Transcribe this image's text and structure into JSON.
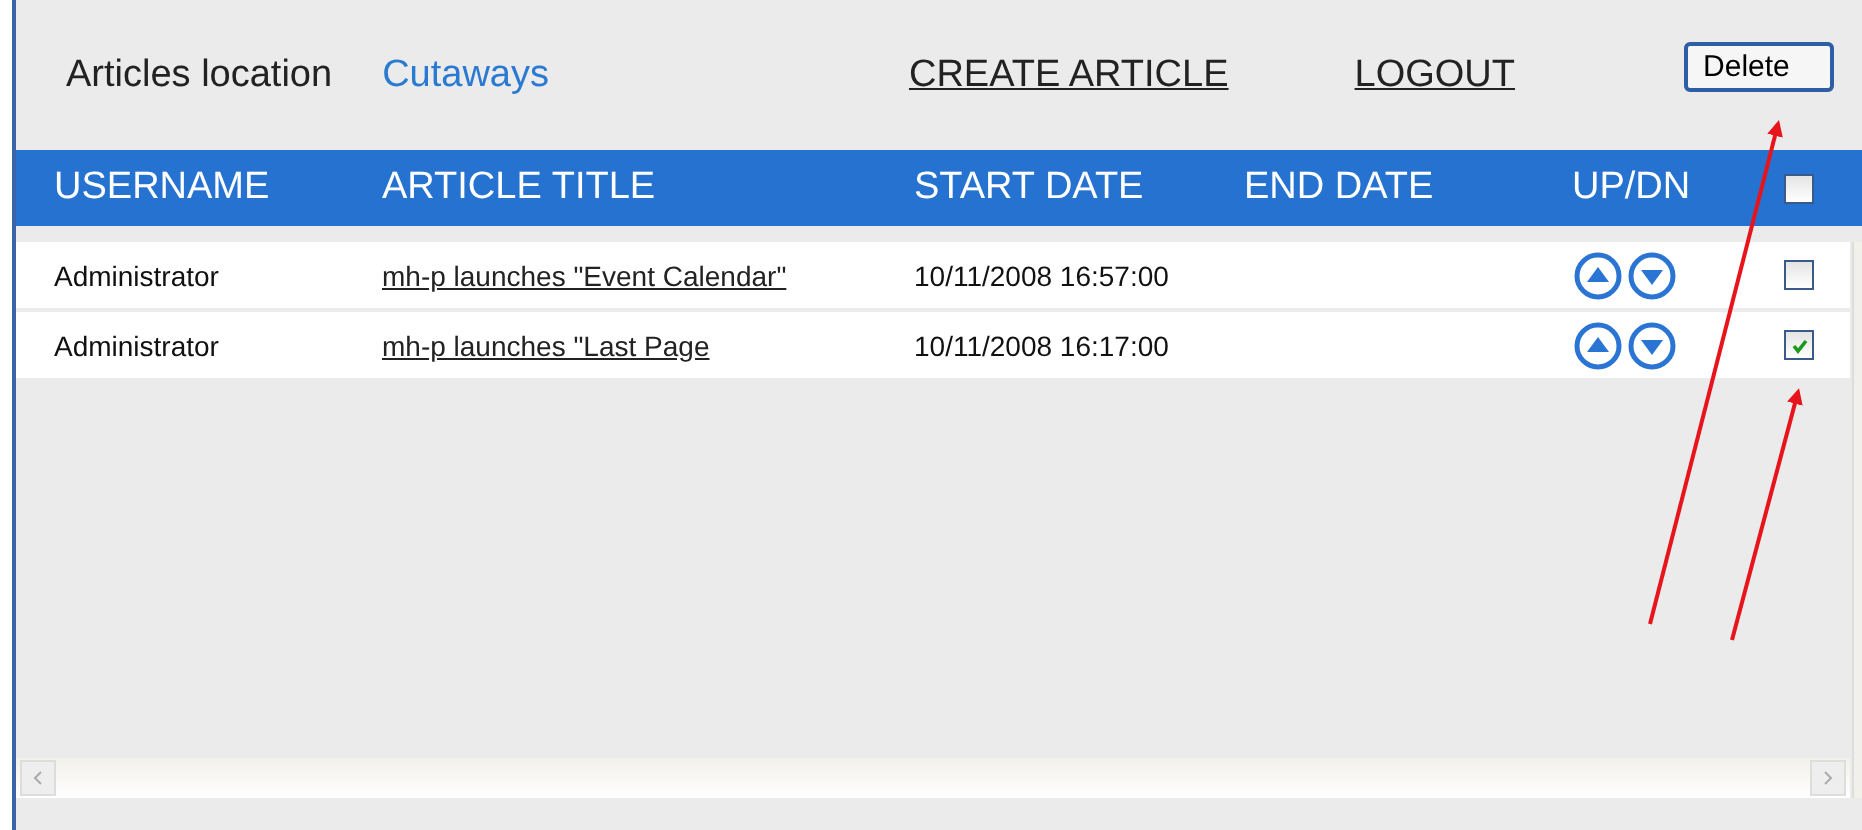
{
  "toolbar": {
    "location_label": "Articles location",
    "location_value": "Cutaways",
    "links": [
      "CREATE ARTICLE",
      "LOGOUT"
    ],
    "delete_button": "Delete"
  },
  "table": {
    "columns": [
      "USERNAME",
      "ARTICLE TITLE",
      "START DATE",
      "END DATE",
      "UP/DN"
    ],
    "select_all_checked": false,
    "rows": [
      {
        "username": "Administrator",
        "title": "mh-p launches \"Event Calendar\"",
        "start_date": "10/11/2008 16:57:00",
        "checked": false
      },
      {
        "username": "Administrator",
        "title": "mh-p launches \"Last Page",
        "start_date": "10/11/2008 16:17:00",
        "checked": true
      }
    ]
  }
}
